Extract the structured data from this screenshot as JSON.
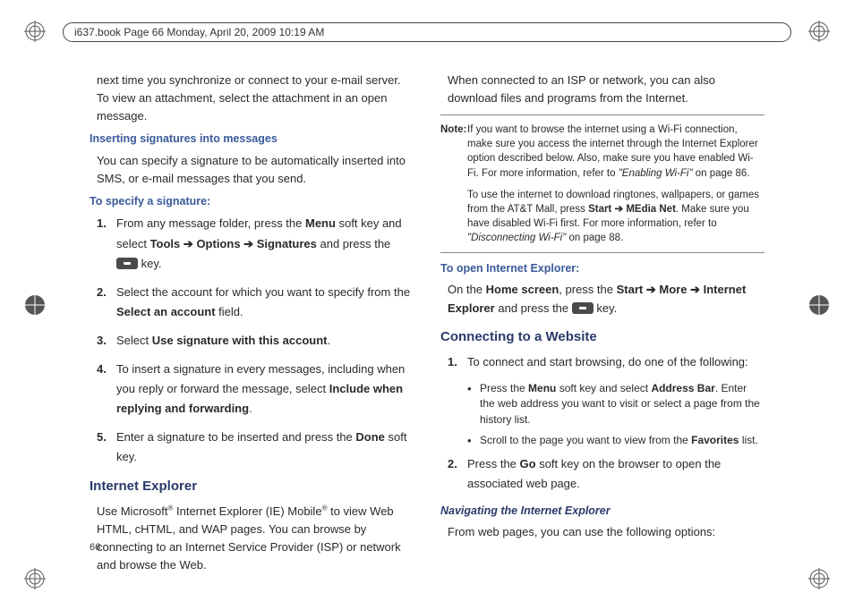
{
  "header": "i637.book  Page 66  Monday, April 20, 2009  10:19 AM",
  "page_number": "66",
  "left": {
    "intro": "next time you synchronize or connect to your e-mail server. To view an attachment, select the attachment in an open message.",
    "sig_heading": "Inserting signatures into messages",
    "sig_desc": "You can specify a signature to be automatically inserted into SMS, or e-mail messages that you send.",
    "spec_heading": "To specify a signature:",
    "step1_a": "From any message folder, press the ",
    "step1_b": " soft key and select ",
    "tools": "Tools",
    "options": "Options",
    "signatures": "Signatures",
    "step1_c": " and press the ",
    "step1_d": " key.",
    "step2_a": "Select the account for which you want to specify from the ",
    "step2_field": "Select an account",
    "step2_b": " field.",
    "step3_a": "Select ",
    "step3_opt": "Use signature with this account",
    "step3_b": ".",
    "step4_a": "To insert a signature in every messages, including when you reply or forward the message, select ",
    "step4_opt": "Include when replying and forwarding",
    "step4_b": ".",
    "step5_a": "Enter a signature to be inserted and press the ",
    "done": "Done",
    "step5_b": " soft key.",
    "ie_heading": "Internet Explorer",
    "ie_desc_a": "Use Microsoft",
    "ie_desc_b": " Internet Explorer (IE) Mobile",
    "ie_desc_c": " to view Web HTML, cHTML, and WAP pages. You can browse by connecting to an Internet Service Provider (ISP) or network and browse the Web.",
    "menu": "Menu",
    "reg": "®"
  },
  "right": {
    "intro": "When connected to an ISP or network, you can also download files and programs from the Internet.",
    "note_label": "Note:",
    "note1_a": "If you want to browse the internet using a Wi-Fi connection, make sure you access the internet through the Internet Explorer option described below. Also, make sure you have enabled Wi-Fi. For more information, refer to ",
    "note1_ref": "\"Enabling Wi-Fi\"",
    "note1_b": "  on page 86.",
    "note2_a": "To use the internet to download ringtones, wallpapers, or games from the AT&T Mall, press ",
    "start": "Start",
    "media_net": "MEdia Net",
    "note2_b": ". Make sure you have disabled Wi-Fi first. For more information, refer to ",
    "note2_ref": "\"Disconnecting Wi-Fi\"",
    "note2_c": "  on page 88.",
    "open_heading": "To open Internet Explorer:",
    "open_a": "On the ",
    "home": "Home screen",
    "open_b": ", press the ",
    "more": "More",
    "ie": "Internet Explorer",
    "open_c": " and press the ",
    "open_d": " key.",
    "connect_heading": "Connecting to a Website",
    "c_step1": "To connect and start browsing, do one of the following:",
    "c_b1_a": "Press the ",
    "menu": "Menu",
    "c_b1_b": " soft key and select ",
    "addr": "Address Bar",
    "c_b1_c": ". Enter the web address you want to visit or select a page from the history list.",
    "c_b2_a": "Scroll to the page you want to view from the ",
    "fav": "Favorites",
    "c_b2_b": " list.",
    "c_step2_a": "Press the ",
    "go": "Go",
    "c_step2_b": " soft key on the browser to open the associated web page.",
    "nav_heading": "Navigating the Internet Explorer",
    "nav_desc": "From web pages, you can use the following options:",
    "arrow": "➔"
  }
}
